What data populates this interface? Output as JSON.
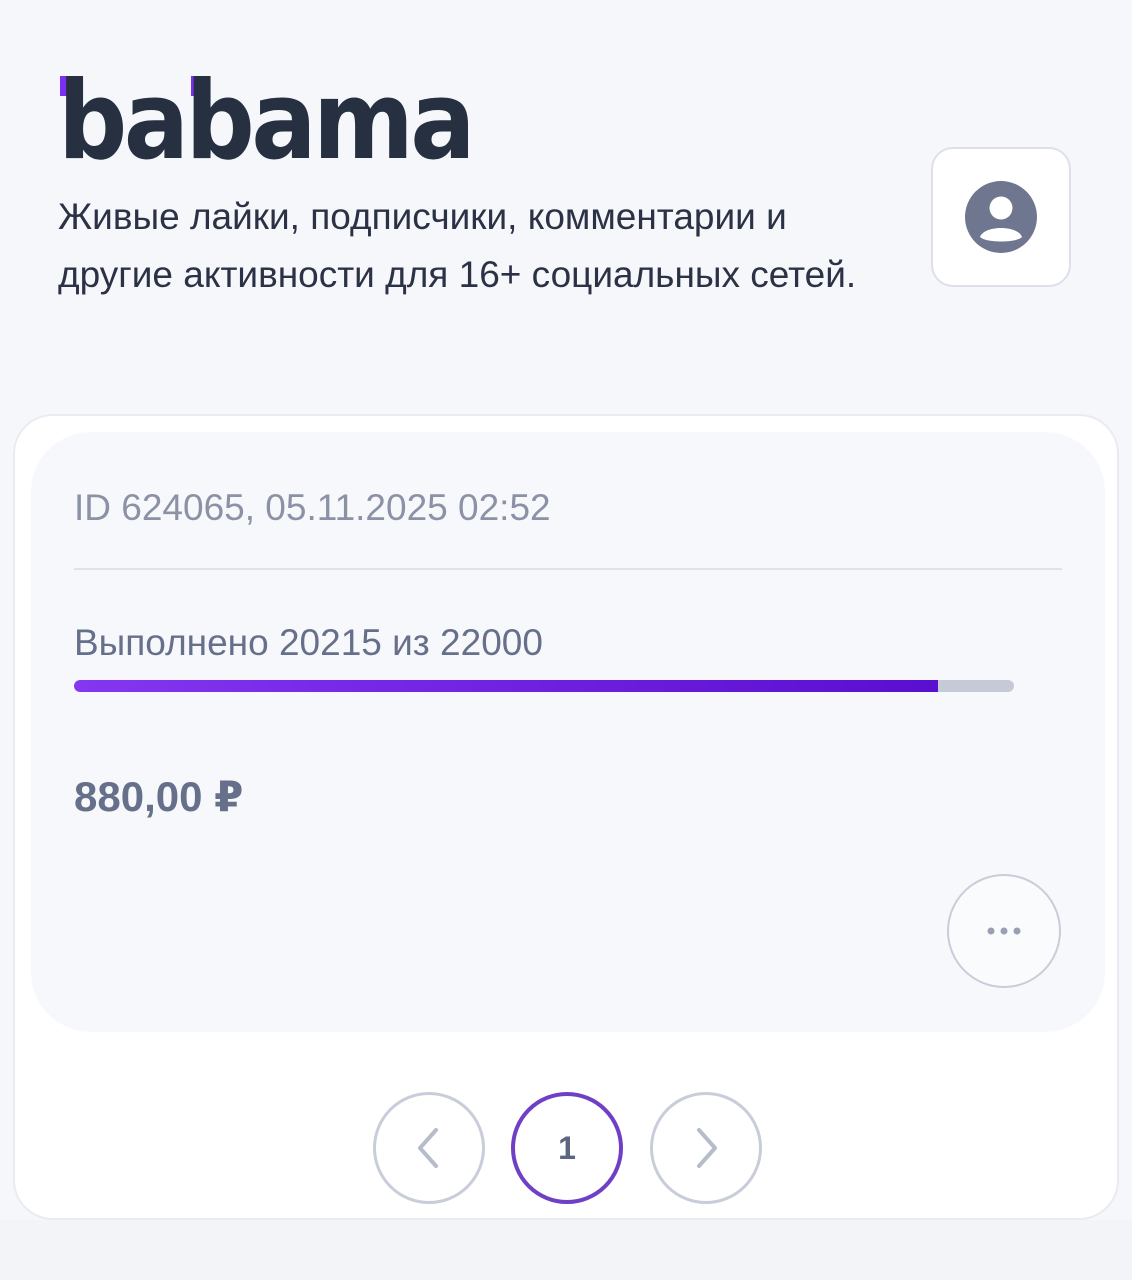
{
  "brand": {
    "logo_text": "babama",
    "accent_color": "#7b2ff0",
    "text_color": "#263041"
  },
  "header": {
    "tagline": "Живые лайки, подписчики, комментарии и другие активности для 16+ социальных сетей.",
    "profile_icon": "user-avatar-icon"
  },
  "order": {
    "meta": "ID 624065, 05.11.2025 02:52",
    "progress_label": "Выполнено 20215 из 22000",
    "completed": 20215,
    "total": 22000,
    "price": "880,00 ₽",
    "more_icon": "ellipsis-icon"
  },
  "pagination": {
    "current_page": "1",
    "prev_icon": "chevron-left-icon",
    "next_icon": "chevron-right-icon"
  },
  "colors": {
    "progress_start": "#8436f0",
    "progress_end": "#5a0fcf",
    "active_page_border": "#6f3fc5"
  }
}
